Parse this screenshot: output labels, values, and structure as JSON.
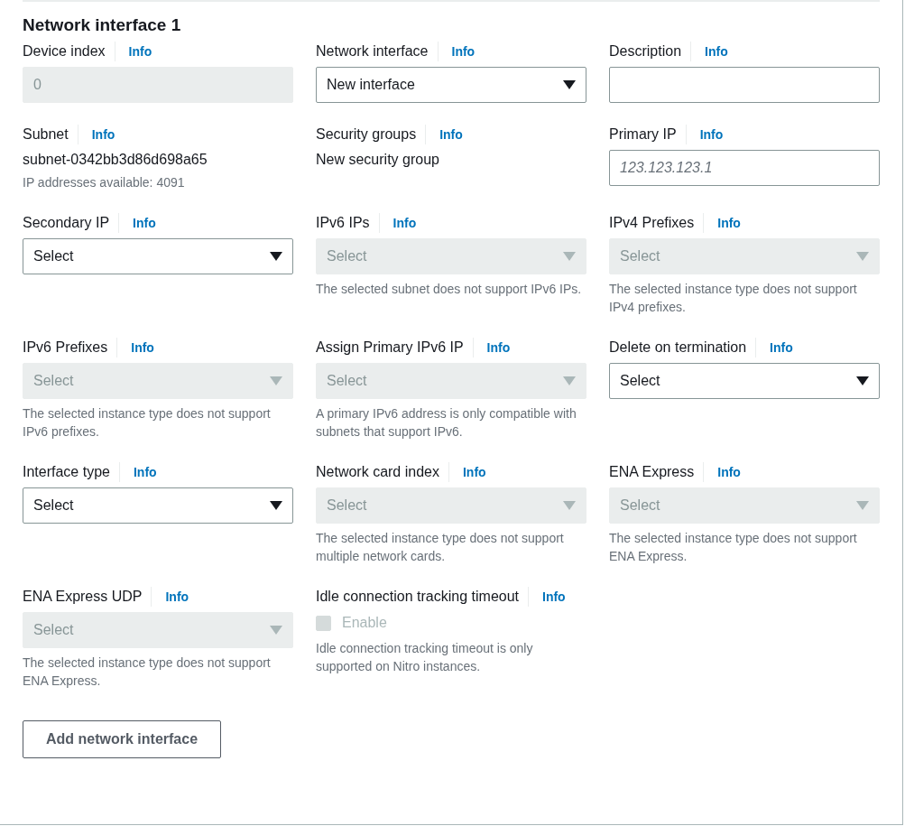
{
  "section_title": "Network interface 1",
  "fields": [
    {
      "kind": "input",
      "label": "Device index",
      "info": "Info",
      "value": "0",
      "disabled": true
    },
    {
      "kind": "select",
      "label": "Network interface",
      "info": "Info",
      "value": "New interface",
      "disabled": false
    },
    {
      "kind": "input",
      "label": "Description",
      "info": "Info",
      "disabled": false
    },
    {
      "kind": "text",
      "label": "Subnet",
      "info": "Info",
      "value": "subnet-0342bb3d86d698a65",
      "hint": "IP addresses available: 4091"
    },
    {
      "kind": "text",
      "label": "Security groups",
      "info": "Info",
      "value": "New security group"
    },
    {
      "kind": "input",
      "label": "Primary IP",
      "info": "Info",
      "placeholder": "123.123.123.1",
      "disabled": false
    },
    {
      "kind": "select",
      "label": "Secondary IP",
      "info": "Info",
      "value": "Select",
      "disabled": false
    },
    {
      "kind": "select",
      "label": "IPv6 IPs",
      "info": "Info",
      "value": "Select",
      "disabled": true,
      "hint": "The selected subnet does not support IPv6 IPs."
    },
    {
      "kind": "select",
      "label": "IPv4 Prefixes",
      "info": "Info",
      "value": "Select",
      "disabled": true,
      "hint": "The selected instance type does not support IPv4 prefixes."
    },
    {
      "kind": "select",
      "label": "IPv6 Prefixes",
      "info": "Info",
      "value": "Select",
      "disabled": true,
      "hint": "The selected instance type does not support IPv6 prefixes."
    },
    {
      "kind": "select",
      "label": "Assign Primary IPv6 IP",
      "info": "Info",
      "value": "Select",
      "disabled": true,
      "hint": "A primary IPv6 address is only compatible with subnets that support IPv6."
    },
    {
      "kind": "select",
      "label": "Delete on termination",
      "info": "Info",
      "value": "Select",
      "disabled": false
    },
    {
      "kind": "select",
      "label": "Interface type",
      "info": "Info",
      "value": "Select",
      "disabled": false
    },
    {
      "kind": "select",
      "label": "Network card index",
      "info": "Info",
      "value": "Select",
      "disabled": true,
      "hint": "The selected instance type does not support multiple network cards."
    },
    {
      "kind": "select",
      "label": "ENA Express",
      "info": "Info",
      "value": "Select",
      "disabled": true,
      "hint": "The selected instance type does not support ENA Express."
    },
    {
      "kind": "select",
      "label": "ENA Express UDP",
      "info": "Info",
      "value": "Select",
      "disabled": true,
      "hint": "The selected instance type does not support ENA Express."
    },
    {
      "kind": "checkbox",
      "label": "Idle connection tracking timeout",
      "info": "Info",
      "checkbox_label": "Enable",
      "checked": false,
      "disabled": true,
      "hint": "Idle connection tracking timeout is only supported on Nitro instances."
    }
  ],
  "add_button": "Add network interface"
}
